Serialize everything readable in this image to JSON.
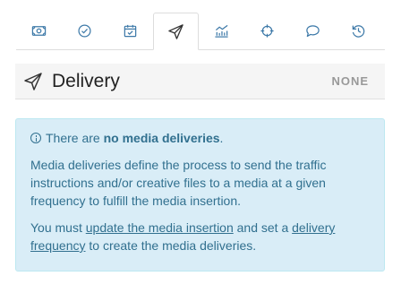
{
  "tabs": [
    {
      "icon": "money-icon",
      "active": false
    },
    {
      "icon": "check-circle-icon",
      "active": false
    },
    {
      "icon": "calendar-check-icon",
      "active": false
    },
    {
      "icon": "paper-plane-icon",
      "active": true
    },
    {
      "icon": "chart-icon",
      "active": false
    },
    {
      "icon": "crosshair-icon",
      "active": false
    },
    {
      "icon": "comment-icon",
      "active": false
    },
    {
      "icon": "history-icon",
      "active": false
    }
  ],
  "header": {
    "title": "Delivery",
    "status": "NONE",
    "icon": "paper-plane-icon"
  },
  "alert": {
    "prefix": "There are ",
    "emphasis": "no media deliveries",
    "suffix": ".",
    "description": "Media deliveries define the process to send the traffic instructions and/or creative files to a media at a given frequency to fulfill the media insertion.",
    "instruction_start": "You must ",
    "link_update": "update the media insertion",
    "instruction_middle": " and set a ",
    "link_frequency": "delivery frequency",
    "instruction_end": " to create the media deliveries."
  },
  "colors": {
    "alert_background": "#d9edf7",
    "alert_text": "#31708f",
    "icon": "#3d79a8"
  }
}
